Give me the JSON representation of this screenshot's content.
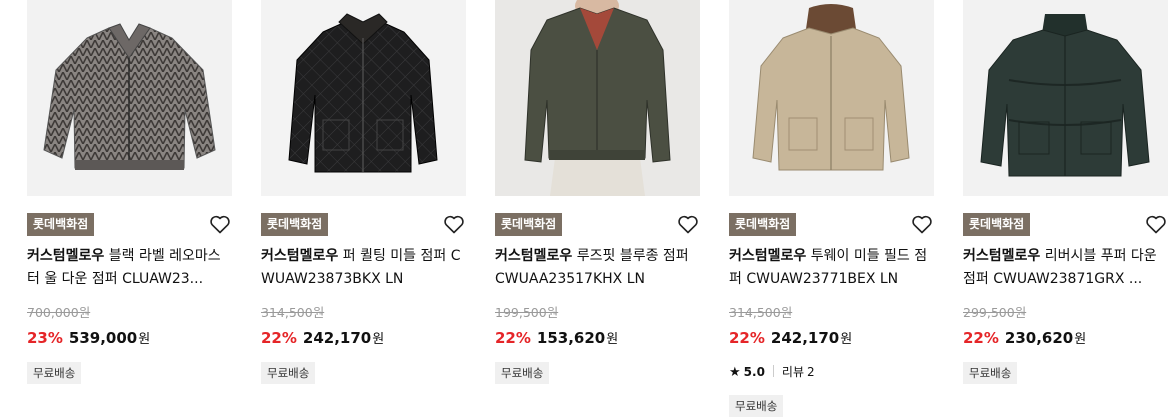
{
  "products": [
    {
      "store": "롯데백화점",
      "brand": "커스텀멜로우",
      "name": "블랙 라벨 레오마스터 울 다운 점퍼 CLUAW23...",
      "original_price": "700,000원",
      "discount": "23%",
      "price": "539,000",
      "currency": "원",
      "shipping": "무료배송",
      "jacket_color": "#8a8582"
    },
    {
      "store": "롯데백화점",
      "brand": "커스텀멜로우",
      "name": "퍼 퀼팅 미들 점퍼 CWUAW23873BKX LN",
      "original_price": "314,500원",
      "discount": "22%",
      "price": "242,170",
      "currency": "원",
      "shipping": "무료배송",
      "jacket_color": "#1e1e1f"
    },
    {
      "store": "롯데백화점",
      "brand": "커스텀멜로우",
      "name": "루즈핏 블루종 점퍼 CWUAA23517KHX LN",
      "original_price": "199,500원",
      "discount": "22%",
      "price": "153,620",
      "currency": "원",
      "shipping": "무료배송",
      "jacket_color": "#4b4f42"
    },
    {
      "store": "롯데백화점",
      "brand": "커스텀멜로우",
      "name": "투웨이 미들 필드 점퍼 CWUAW23771BEX LN",
      "original_price": "314,500원",
      "discount": "22%",
      "price": "242,170",
      "currency": "원",
      "rating": "5.0",
      "reviews_label": "리뷰",
      "reviews_count": "2",
      "shipping": "무료배송",
      "jacket_color": "#c7b699"
    },
    {
      "store": "롯데백화점",
      "brand": "커스텀멜로우",
      "name": "리버시블 푸퍼 다운점퍼 CWUAW23871GRX ...",
      "original_price": "299,500원",
      "discount": "22%",
      "price": "230,620",
      "currency": "원",
      "shipping": "무료배송",
      "jacket_color": "#2d3b37"
    }
  ]
}
